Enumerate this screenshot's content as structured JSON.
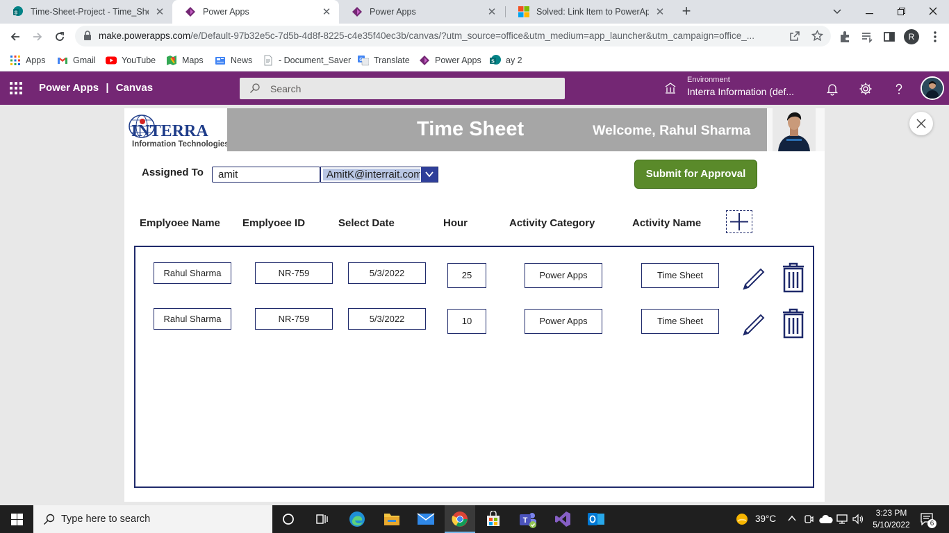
{
  "browser": {
    "tabs": [
      {
        "title": "Time-Sheet-Project - Time_Sheet",
        "icon": "sharepoint-icon",
        "active": false
      },
      {
        "title": "Power Apps",
        "icon": "powerapps-icon",
        "active": true
      },
      {
        "title": "Power Apps",
        "icon": "powerapps-icon",
        "active": false
      },
      {
        "title": "Solved: Link Item to PowerApps d",
        "icon": "microsoft-icon",
        "active": false
      }
    ],
    "url_host": "make.powerapps.com",
    "url_rest": "/e/Default-97b32e5c-7d5b-4d8f-8225-c4e35f40ec3b/canvas/?utm_source=office&utm_medium=app_launcher&utm_campaign=office_...",
    "profile_initial": "R",
    "bookmarks": [
      "Apps",
      "Gmail",
      "YouTube",
      "Maps",
      "News",
      "- Document_Saver",
      "Translate",
      "Power Apps",
      "ay 2"
    ]
  },
  "header": {
    "product": "Power Apps",
    "separator": "|",
    "mode": "Canvas",
    "search_placeholder": "Search",
    "environment_label": "Environment",
    "environment_value": "Interra Information (def...",
    "brand_color": "#742774"
  },
  "app": {
    "logo_text": "INTERRA",
    "logo_subtitle": "Information Technologies",
    "title": "Time Sheet",
    "welcome": "Welcome,  Rahul Sharma",
    "assigned_label": "Assigned To",
    "assigned_search": "amit",
    "assigned_email": "AmitK@interrait.com",
    "submit_label": "Submit for Approval",
    "submit_color": "#5a8a2a",
    "columns": [
      "Emplyoee Name",
      "Emplyoee ID",
      "Select Date",
      "Hour",
      "Activity Category",
      "Activity Name"
    ],
    "rows": [
      {
        "name": "Rahul Sharma",
        "id": "NR-759",
        "date": "5/3/2022",
        "hour": "25",
        "category": "Power Apps",
        "activity": "Time Sheet"
      },
      {
        "name": "Rahul Sharma",
        "id": "NR-759",
        "date": "5/3/2022",
        "hour": "10",
        "category": "Power Apps",
        "activity": "Time Sheet"
      }
    ]
  },
  "taskbar": {
    "search_placeholder": "Type here to search",
    "temperature": "39°C",
    "time": "3:23 PM",
    "date": "5/10/2022",
    "notification_count": "6"
  }
}
